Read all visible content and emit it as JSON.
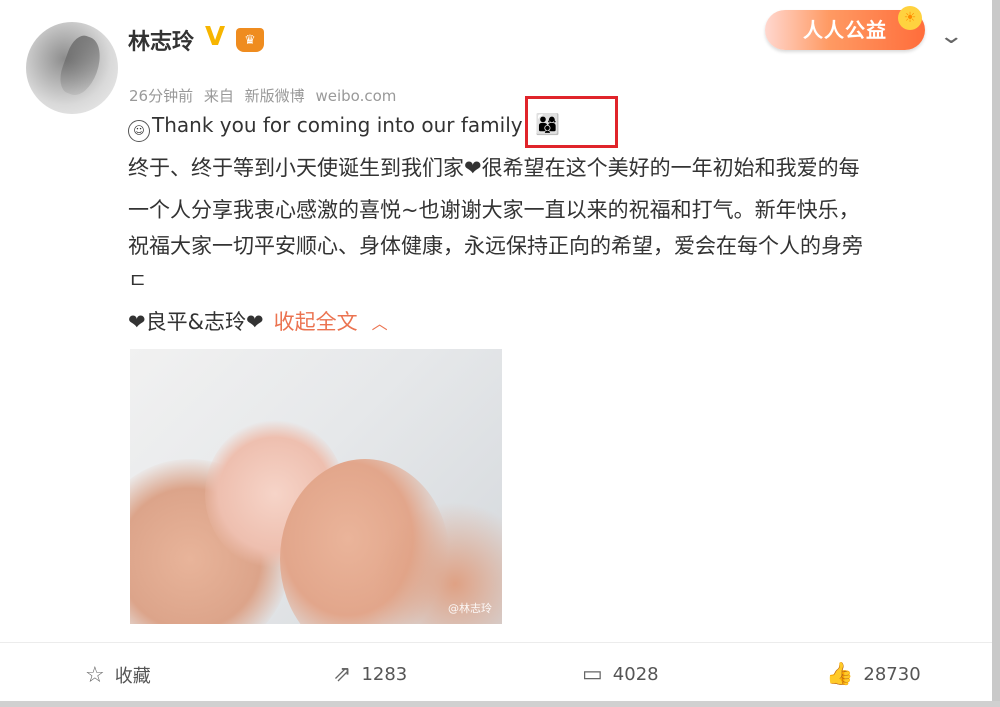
{
  "post": {
    "username": "林志玲",
    "verified_badge": "V",
    "meta": {
      "time": "26分钟前",
      "source_prefix": "来自",
      "source": "新版微博",
      "source_domain": "weibo.com"
    },
    "charity_badge": "人人公益",
    "first_line": "Thank you for coming into our family",
    "family_emojis": "👨‍👩‍👦",
    "body_lines": [
      "终于、终于等到小天使诞生到我们家❤很希望在这个美好的一年初始和我爱的每",
      "一个人分享我衷心感激的喜悦~也谢谢大家一直以来的祝福和打气。新年快乐，",
      "祝福大家一切平安顺心、身体健康，永远保持正向的希望，爱会在每个人的身旁",
      "ㄷ"
    ],
    "signature": "❤良平&志玲❤",
    "collapse_label": "收起全文",
    "image_watermark": "@林志玲"
  },
  "actions": {
    "favorite": {
      "icon": "star-icon",
      "label": "收藏"
    },
    "repost": {
      "icon": "share-icon",
      "count": "1283"
    },
    "comment": {
      "icon": "comment-icon",
      "count": "4028"
    },
    "like": {
      "icon": "thumbs-up-icon",
      "count": "28730"
    }
  },
  "colors": {
    "accent": "#eb7350",
    "highlight_box": "#e0242a"
  }
}
